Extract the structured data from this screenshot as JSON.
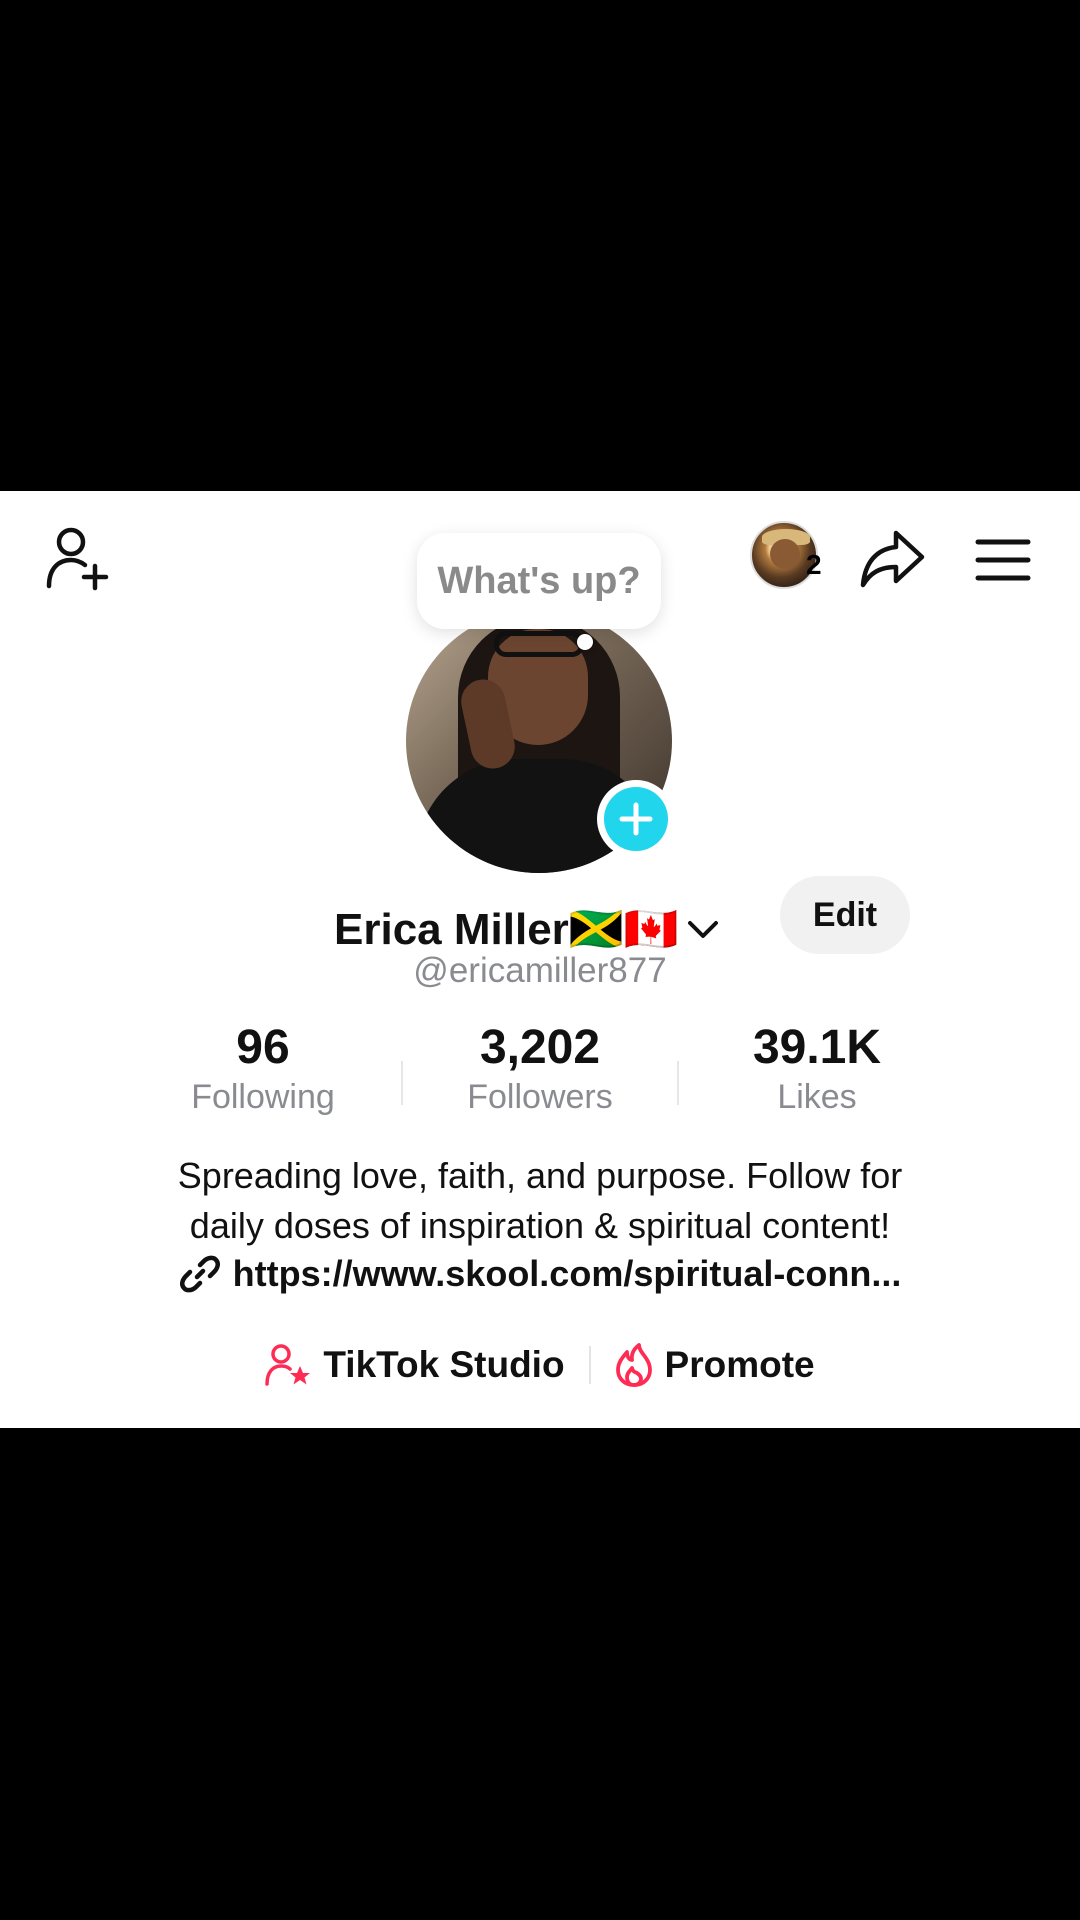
{
  "header": {
    "add_friend_icon": "person-plus-icon",
    "story_count": "2",
    "share_icon": "share-arrow-icon",
    "menu_icon": "hamburger-menu-icon"
  },
  "note_bubble": {
    "text": "What's up?"
  },
  "profile": {
    "name": "Erica Miller🇯🇲🇨🇦",
    "handle": "@ericamiller877",
    "edit_label": "Edit"
  },
  "stats": [
    {
      "value": "96",
      "label": "Following"
    },
    {
      "value": "3,202",
      "label": "Followers"
    },
    {
      "value": "39.1K",
      "label": "Likes"
    }
  ],
  "bio": {
    "line1": "Spreading love, faith, and purpose. Follow for",
    "line2": "daily doses of inspiration & spiritual content!",
    "link": "https://www.skool.com/spiritual-conn..."
  },
  "actions": {
    "studio_label": "TikTok Studio",
    "promote_label": "Promote"
  },
  "colors": {
    "accent_cyan": "#20d5ec",
    "accent_pink": "#fe2c55",
    "muted_text": "#8a8b91"
  }
}
